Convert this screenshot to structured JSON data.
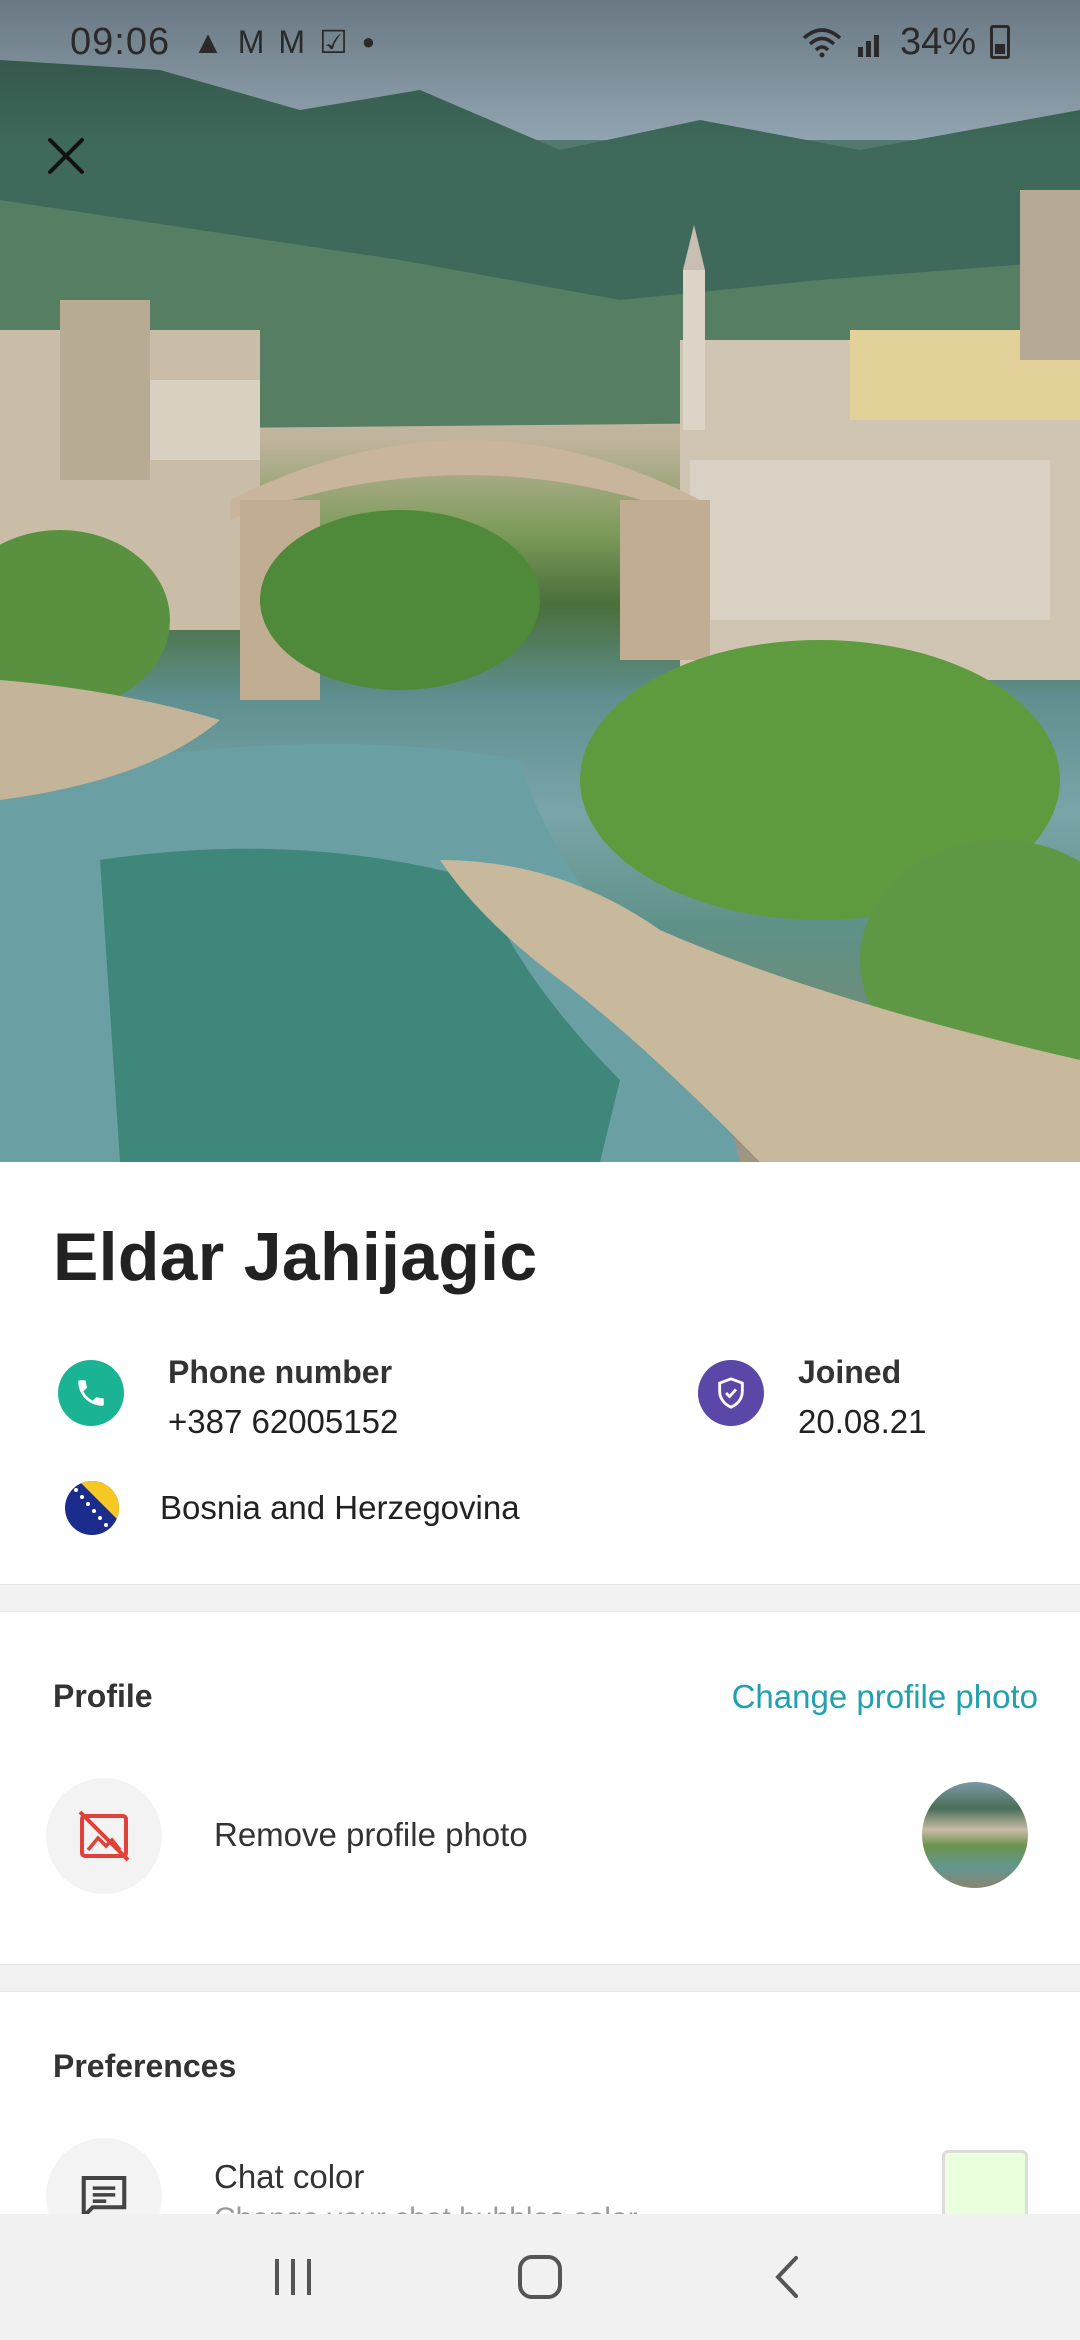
{
  "status_bar": {
    "time": "09:06",
    "battery": "34%",
    "left_icons": [
      "notification-icon",
      "gmail-icon",
      "gmail-icon",
      "task-icon",
      "dot-icon"
    ],
    "right_icons": [
      "wifi-icon",
      "signal-icon",
      "battery-icon"
    ]
  },
  "profile": {
    "name": "Eldar Jahijagic",
    "phone_label": "Phone number",
    "phone_value": "+387 62005152",
    "joined_label": "Joined",
    "joined_value": "20.08.21",
    "country": "Bosnia and Herzegovina"
  },
  "profile_section": {
    "title": "Profile",
    "change_link": "Change profile photo",
    "remove_label": "Remove profile photo"
  },
  "preferences_section": {
    "title": "Preferences",
    "chat_color_label": "Chat color",
    "chat_color_sub": "Change your chat bubbles color",
    "chat_color_value": "#eaffdc"
  },
  "colors": {
    "accent": "#1fa1b0",
    "phone_icon_bg": "#1ab394",
    "shield_icon_bg": "#5b47a8",
    "remove_icon": "#e0413a"
  }
}
